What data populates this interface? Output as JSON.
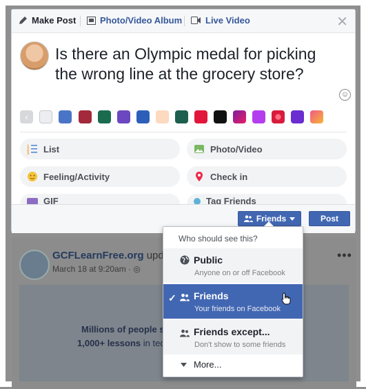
{
  "tabs": {
    "make_post": "Make Post",
    "photo_album": "Photo/Video Album",
    "live_video": "Live Video"
  },
  "composer": {
    "post_text": "Is there an Olympic medal for picking the wrong line at the grocery store?",
    "close_icon": "close-icon",
    "emoji_icon": "smiley-icon"
  },
  "background_swatches": [
    "#e9ebf0",
    "#4a74c6",
    "#a3293b",
    "#1b6b4f",
    "#6b48c0",
    "#2d5fba",
    "#fcd9bf",
    "#1d5f4e",
    "#e2163a",
    "#111111",
    "#b22898",
    "#b43df0",
    "#e0304c",
    "#6a2dd0",
    "#f79a3a"
  ],
  "options": {
    "list": "List",
    "photo_video": "Photo/Video",
    "feeling": "Feeling/Activity",
    "check_in": "Check in",
    "gif": "GIF",
    "tag_friends": "Tag Friends"
  },
  "footer": {
    "audience": "Friends",
    "post": "Post"
  },
  "audience_menu": {
    "header": "Who should see this?",
    "public_title": "Public",
    "public_sub": "Anyone on or off Facebook",
    "friends_title": "Friends",
    "friends_sub": "Your friends on Facebook",
    "except_title": "Friends except...",
    "except_sub": "Don't show to some friends",
    "more": "More...",
    "selected": "Friends"
  },
  "feed": {
    "page_name": "GCFLearnFree.org",
    "page_name_rest": " updat",
    "date": "March 18 at 9:20am · ",
    "image_line1": "Millions of people serv",
    "image_line2_bold": "1,000+ lessons",
    "image_line2_rest": " in tec"
  },
  "colors": {
    "brand_blue": "#4267b2",
    "link_blue": "#365899"
  }
}
